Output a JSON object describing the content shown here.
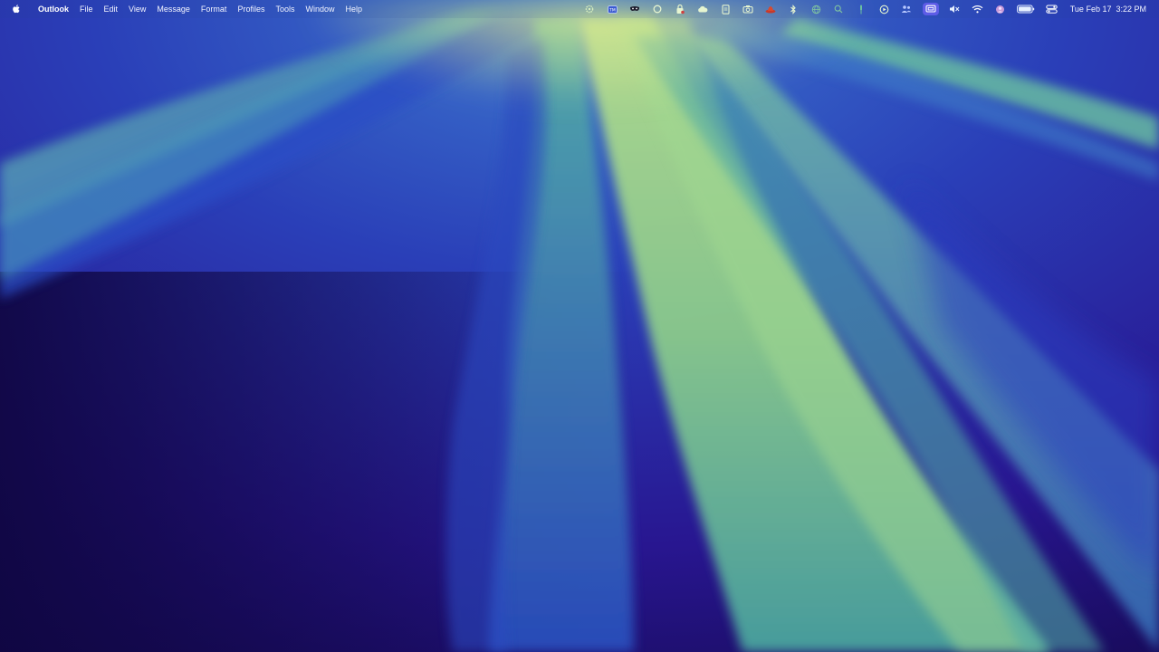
{
  "menubar": {
    "apple_icon": "apple-logo-icon",
    "app_name": "Outlook",
    "menus": [
      "File",
      "Edit",
      "View",
      "Message",
      "Format",
      "Profiles",
      "Tools",
      "Window",
      "Help"
    ],
    "status_icons": [
      "settings-gear-icon",
      "tm-badge-icon",
      "mask-icon",
      "circle-status-icon",
      "shield-lock-icon",
      "cloud-sync-icon",
      "document-icon",
      "camera-icon",
      "red-hat-icon",
      "bluetooth-icon",
      "globe-icon",
      "search-icon",
      "dropper-icon",
      "play-circle-icon",
      "people-icon",
      "screen-mirroring-icon",
      "mute-icon",
      "wifi-icon",
      "user-avatar-icon",
      "battery-icon",
      "control-center-icon"
    ],
    "date": "Tue Feb 17",
    "time": "3:22 PM"
  }
}
